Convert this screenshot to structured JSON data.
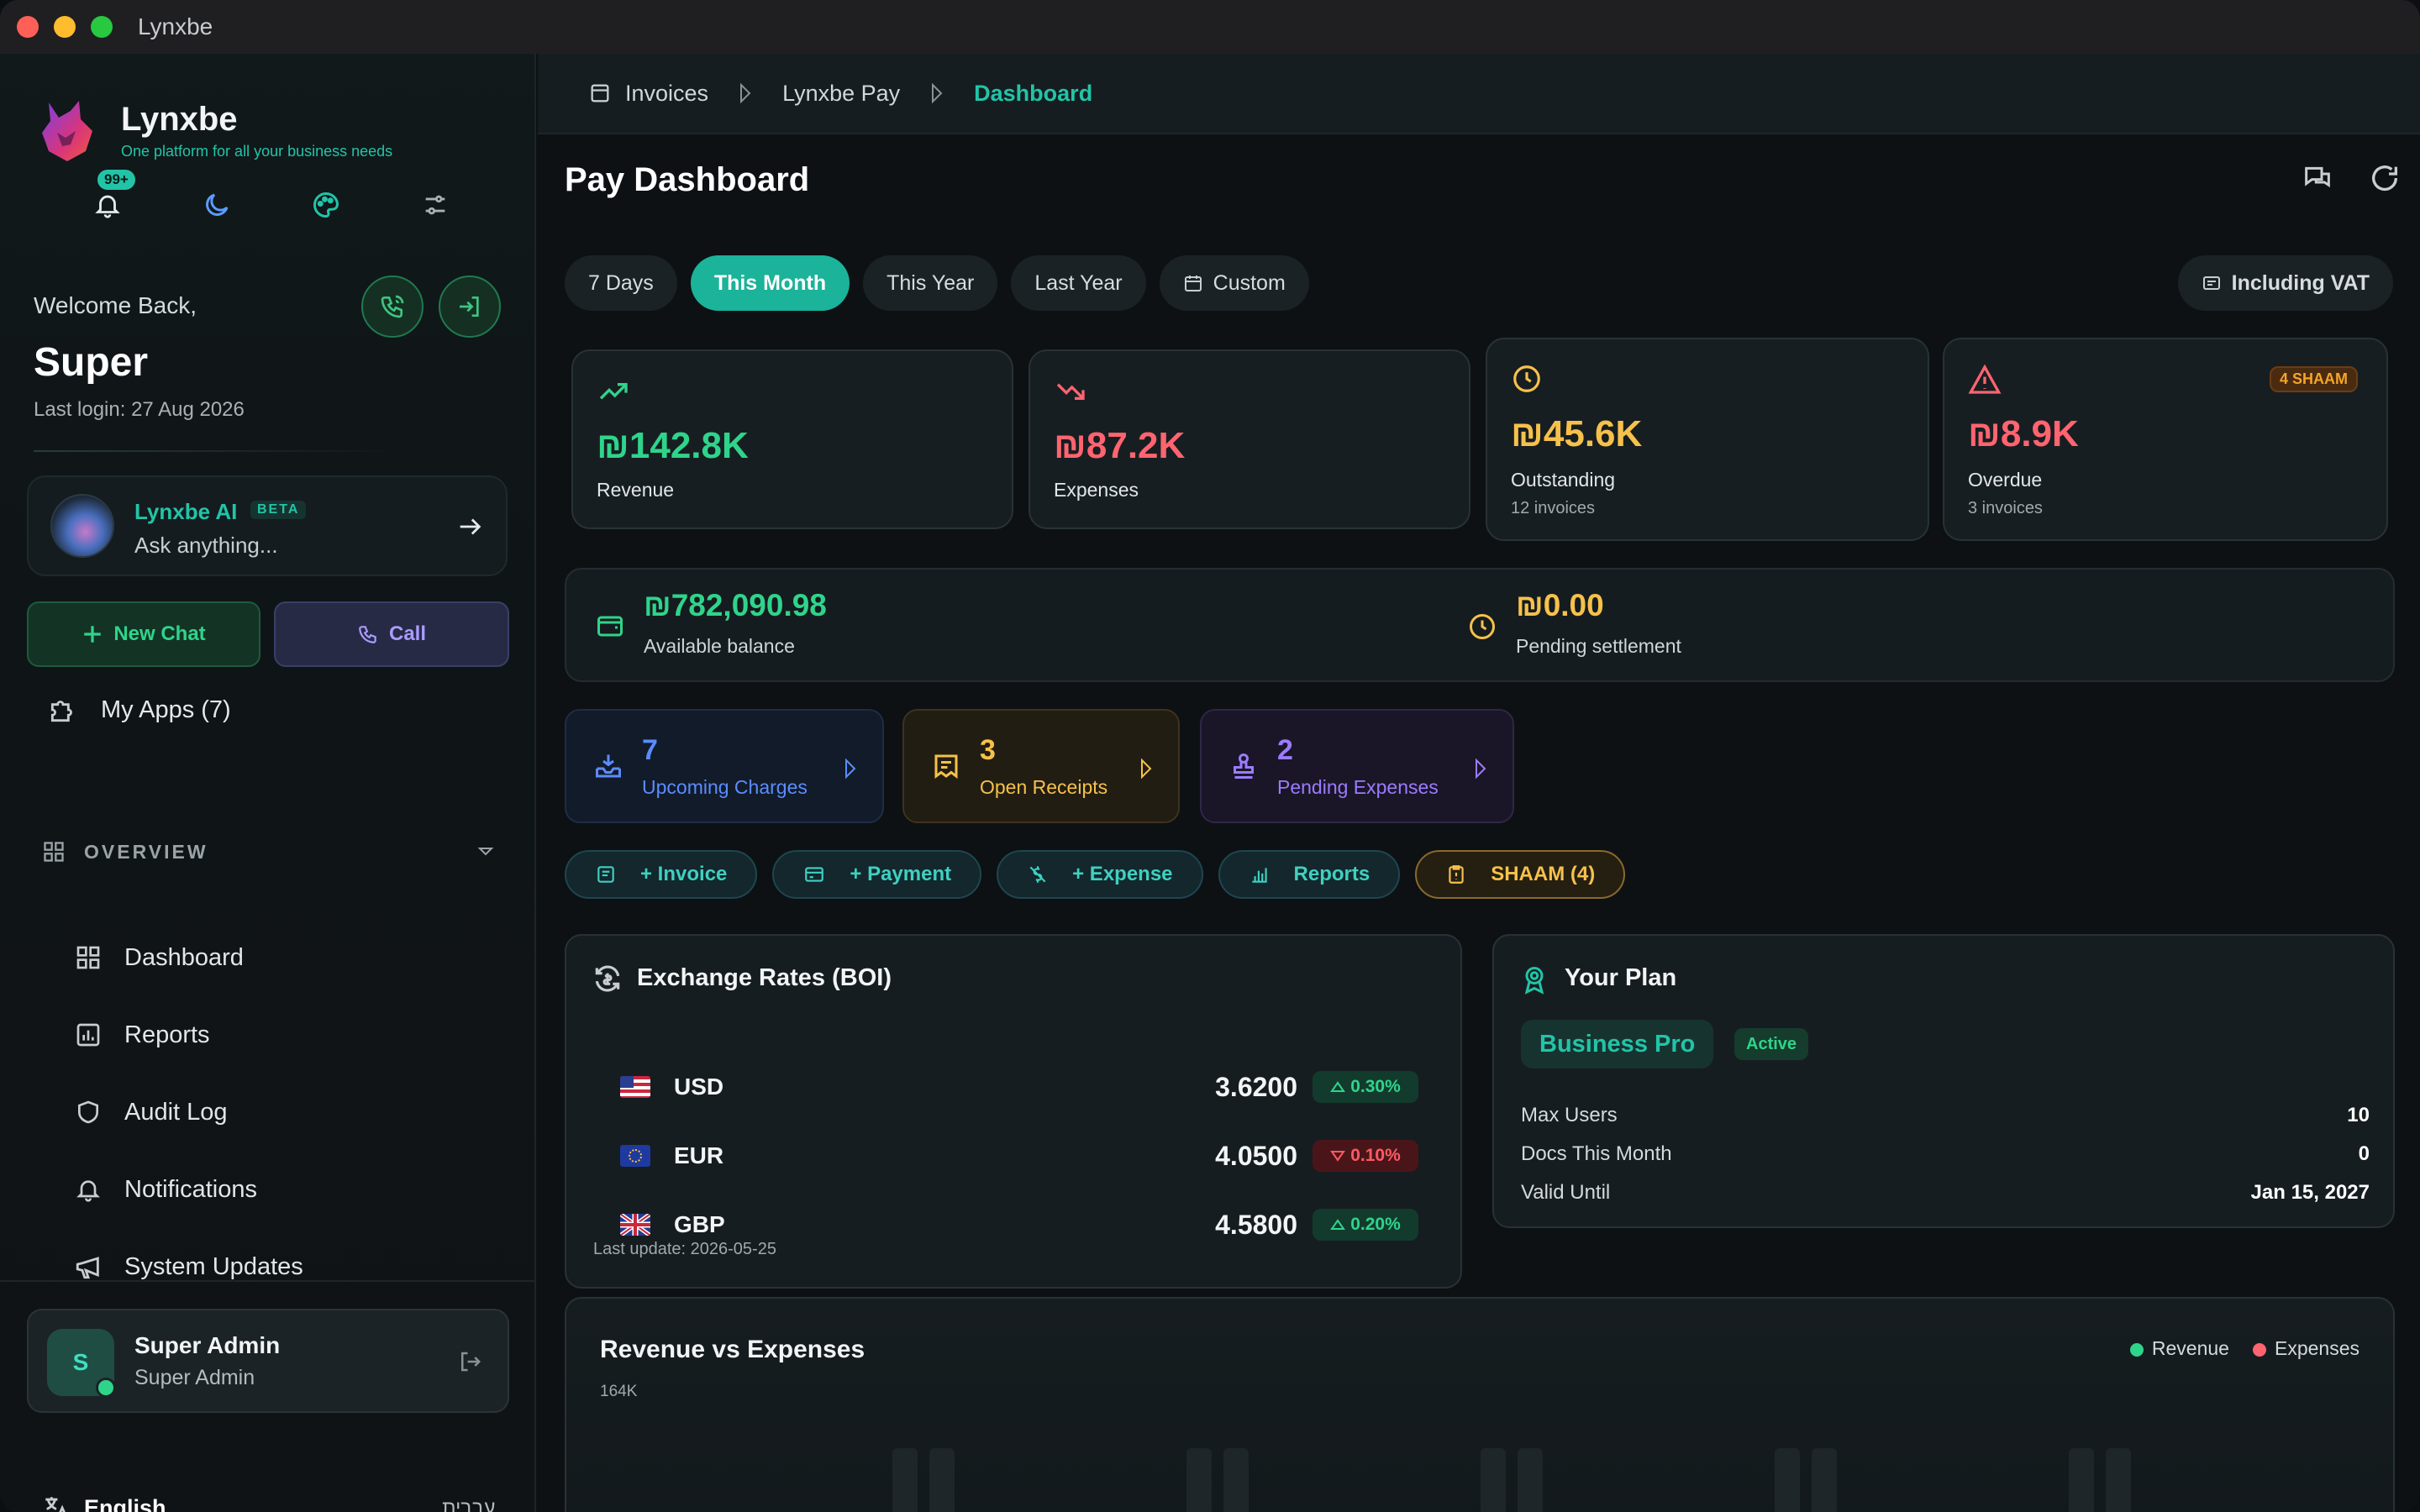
{
  "window": {
    "title": "Lynxbe"
  },
  "brand": {
    "name": "Lynxbe",
    "tagline": "One platform for all your business needs"
  },
  "notifications": {
    "badge": "99+"
  },
  "welcome": {
    "greeting": "Welcome Back,",
    "user": "Super",
    "last_login": "Last login: 27 Aug 2026"
  },
  "ai": {
    "title": "Lynxbe AI",
    "beta": "BETA",
    "placeholder": "Ask anything..."
  },
  "sidebar_buttons": {
    "new_chat": "New Chat",
    "call": "Call"
  },
  "my_apps": "My Apps (7)",
  "overview": {
    "label": "OVERVIEW",
    "items": [
      {
        "label": "Dashboard",
        "icon": "grid-icon"
      },
      {
        "label": "Reports",
        "icon": "chart-icon"
      },
      {
        "label": "Audit Log",
        "icon": "shield-icon"
      },
      {
        "label": "Notifications",
        "icon": "bell-icon"
      },
      {
        "label": "System Updates",
        "icon": "megaphone-icon"
      }
    ]
  },
  "user_card": {
    "initial": "S",
    "name": "Super Admin",
    "role": "Super Admin"
  },
  "language": {
    "current": "English",
    "alt": "עברית"
  },
  "breadcrumb": {
    "items": [
      "Invoices",
      "Lynxbe Pay",
      "Dashboard"
    ]
  },
  "page": {
    "title": "Pay Dashboard"
  },
  "filters": {
    "options": [
      "7 Days",
      "This Month",
      "This Year",
      "Last Year",
      "Custom"
    ],
    "active": "This Month",
    "vat": "Including VAT"
  },
  "kpis": {
    "revenue": {
      "value": "₪142.8K",
      "label": "Revenue"
    },
    "expenses": {
      "value": "₪87.2K",
      "label": "Expenses"
    },
    "outstanding": {
      "value": "₪45.6K",
      "label": "Outstanding",
      "sub": "12 invoices"
    },
    "overdue": {
      "value": "₪8.9K",
      "label": "Overdue",
      "sub": "3 invoices",
      "badge": "4 SHAAM"
    }
  },
  "balance": {
    "available_value": "₪782,090.98",
    "available_label": "Available balance",
    "pending_value": "₪0.00",
    "pending_label": "Pending settlement"
  },
  "mini": {
    "charges": {
      "count": "7",
      "label": "Upcoming Charges"
    },
    "receipts": {
      "count": "3",
      "label": "Open Receipts"
    },
    "expenses": {
      "count": "2",
      "label": "Pending Expenses"
    }
  },
  "actions": {
    "invoice": "+ Invoice",
    "payment": "+ Payment",
    "expense": "+ Expense",
    "reports": "Reports",
    "shaam": "SHAAM (4)"
  },
  "fx": {
    "title": "Exchange Rates (BOI)",
    "rows": [
      {
        "code": "USD",
        "rate": "3.6200",
        "change": "0.30%",
        "dir": "up"
      },
      {
        "code": "EUR",
        "rate": "4.0500",
        "change": "0.10%",
        "dir": "down"
      },
      {
        "code": "GBP",
        "rate": "4.5800",
        "change": "0.20%",
        "dir": "up"
      }
    ],
    "updated": "Last update: 2026-05-25"
  },
  "plan": {
    "title": "Your Plan",
    "name": "Business Pro",
    "status": "Active",
    "rows": [
      {
        "label": "Max Users",
        "value": "10"
      },
      {
        "label": "Docs This Month",
        "value": "0"
      },
      {
        "label": "Valid Until",
        "value": "Jan 15, 2027"
      }
    ]
  },
  "revenue_chart": {
    "title": "Revenue vs Expenses",
    "legend": [
      "Revenue",
      "Expenses"
    ],
    "ytick": "164K"
  },
  "colors": {
    "accent": "#22c4a7",
    "revenue": "#2fd48b",
    "expenses": "#ff6470",
    "warning": "#f6c14b",
    "purple": "#9b7bff",
    "blue": "#5b8cff"
  }
}
